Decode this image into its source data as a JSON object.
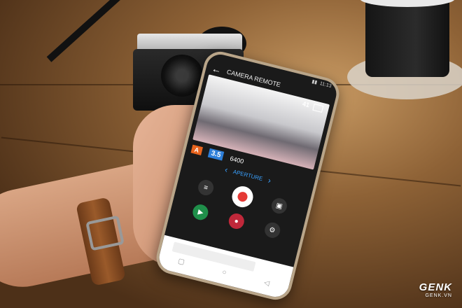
{
  "app": {
    "title": "CAMERA REMOTE"
  },
  "status": {
    "time": "11:13",
    "battery_icon": "battery-icon",
    "signal_icon": "signal-icon"
  },
  "viewfinder": {
    "shots_remaining": "41"
  },
  "exposure": {
    "mode": "A",
    "aperture_value": "3.5",
    "iso_value": "6400",
    "mode_label": "APERTURE"
  },
  "icons": {
    "back": "back-arrow-icon",
    "menu": "menu-icon",
    "shutter": "shutter-button",
    "gallery": "gallery-icon",
    "playback": "playback-icon",
    "video": "video-icon"
  },
  "watermark": {
    "brand": "GENK",
    "site": "GENK.VN"
  },
  "colors": {
    "mode_badge": "#e8641e",
    "aperture_badge": "#2e7fd9",
    "accent": "#3aa1ff",
    "record": "#c0283a"
  }
}
